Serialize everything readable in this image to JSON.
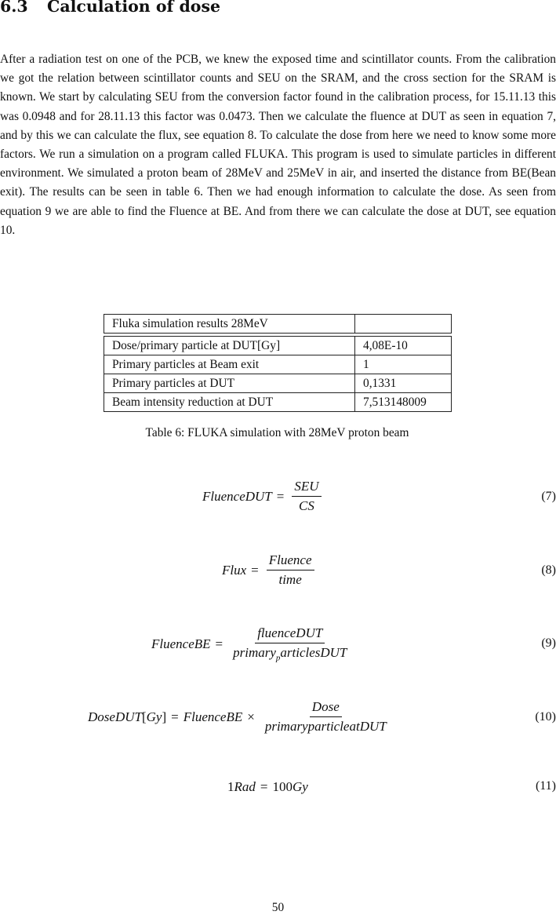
{
  "section": {
    "number": "6.3",
    "title": "Calculation of dose"
  },
  "paragraph": "After a radiation test on one of the PCB, we knew the exposed time and scintillator counts. From the calibration we got the relation between scintillator counts and SEU on the SRAM, and the cross section for the SRAM is known. We start by calculating SEU from the conversion factor found in the calibration process, for 15.11.13 this was 0.0948 and for 28.11.13 this factor was 0.0473. Then we calculate the fluence at DUT as seen in equation 7, and by this we can calculate the flux, see equation 8. To calculate the dose from here we need to know some more factors. We run a simulation on a program called FLUKA. This program is used to simulate particles in different environment. We simulated a proton beam of 28MeV and 25MeV in air, and inserted the distance from BE(Bean exit). The results can be seen in table 6. Then we had enough information to calculate the dose. As seen from equation 9 we are able to find the Fluence at BE. And from there we can calculate the dose at DUT, see equation 10.",
  "table": {
    "header": [
      "Fluka simulation results 28MeV",
      ""
    ],
    "rows": [
      [
        "Dose/primary particle at DUT[Gy]",
        "4,08E-10"
      ],
      [
        "Primary particles at Beam exit",
        "1"
      ],
      [
        "Primary particles at DUT",
        "0,1331"
      ],
      [
        "Beam intensity reduction at DUT",
        "7,513148009"
      ]
    ],
    "caption": "Table 6: FLUKA simulation with 28MeV proton beam"
  },
  "equations": {
    "eq7": {
      "lhs": "FluenceDUT",
      "eq": "=",
      "num": "SEU",
      "den": "CS",
      "number": "(7)"
    },
    "eq8": {
      "lhs": "Flux",
      "eq": "=",
      "num": "Fluence",
      "den": "time",
      "number": "(8)"
    },
    "eq9": {
      "lhs": "FluenceBE",
      "eq": "=",
      "num": "fluenceDUT",
      "den_pre": "primary",
      "den_sub": "p",
      "den_post": "articlesDUT",
      "number": "(9)"
    },
    "eq10": {
      "lhs_a": "DoseDUT",
      "lhs_b": "[",
      "lhs_c": "Gy",
      "lhs_d": "]",
      "eq": "=",
      "mid": "FluenceBE",
      "times": "×",
      "num": "Dose",
      "den": "primaryparticleatDUT",
      "number": "(10)"
    },
    "eq11": {
      "lhs_num": "1",
      "lhs_var": "Rad",
      "eq": "=",
      "rhs_num": "100",
      "rhs_var": "Gy",
      "number": "(11)"
    }
  },
  "page_number": "50"
}
